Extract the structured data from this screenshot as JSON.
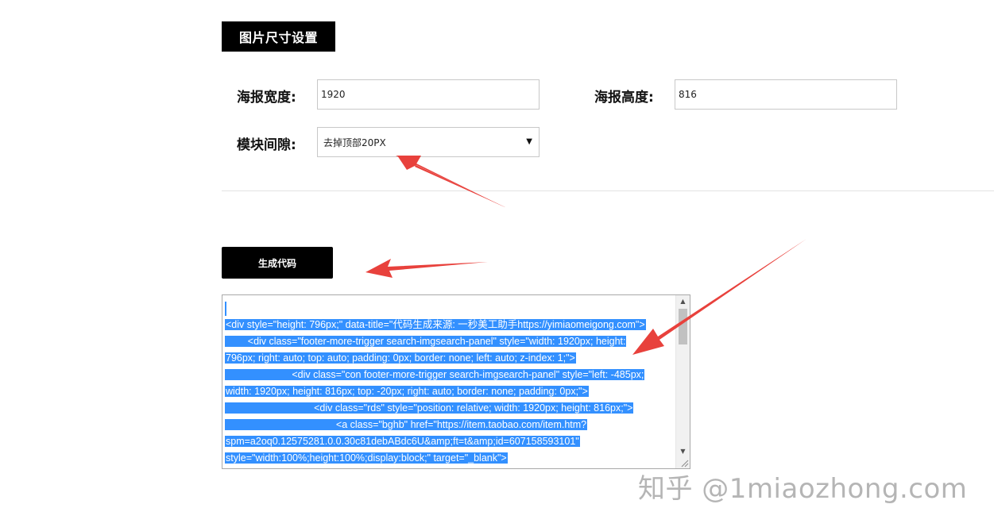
{
  "section": {
    "title": "图片尺寸设置"
  },
  "form": {
    "width_label": "海报宽度:",
    "width_value": "1920",
    "height_label": "海报高度:",
    "height_value": "816",
    "gap_label": "模块间隙:",
    "gap_selected": "去掉顶部20PX"
  },
  "actions": {
    "generate_label": "生成代码"
  },
  "code_output": {
    "lines": [
      "<div style=\"height: 796px;\" data-title=\"代码生成来源: 一秒美工助手https://yimiaomeigong.com\">",
      "        <div class=\"footer-more-trigger search-imgsearch-panel\" style=\"width: 1920px; height:",
      "796px; right: auto; top: auto; padding: 0px; border: none; left: auto; z-index: 1;\">",
      "                        <div class=\"con footer-more-trigger search-imgsearch-panel\" style=\"left: -485px;",
      "width: 1920px; height: 816px; top: -20px; right: auto; border: none; padding: 0px;\">",
      "                                <div class=\"rds\" style=\"position: relative; width: 1920px; height: 816px;\">",
      "                                        <a class=\"bghb\" href=\"https://item.taobao.com/item.htm?",
      "spm=a2oq0.12575281.0.0.30c81debABdc6U&amp;ft=t&amp;id=607158593101\"",
      "style=\"width:100%;height:100%;display:block;\" target=\"_blank\">"
    ]
  },
  "watermark": {
    "text": "知乎 @1miaozhong.com"
  },
  "colors": {
    "accent": "#000000",
    "selection": "#3390ff",
    "arrow": "#e8413c"
  }
}
